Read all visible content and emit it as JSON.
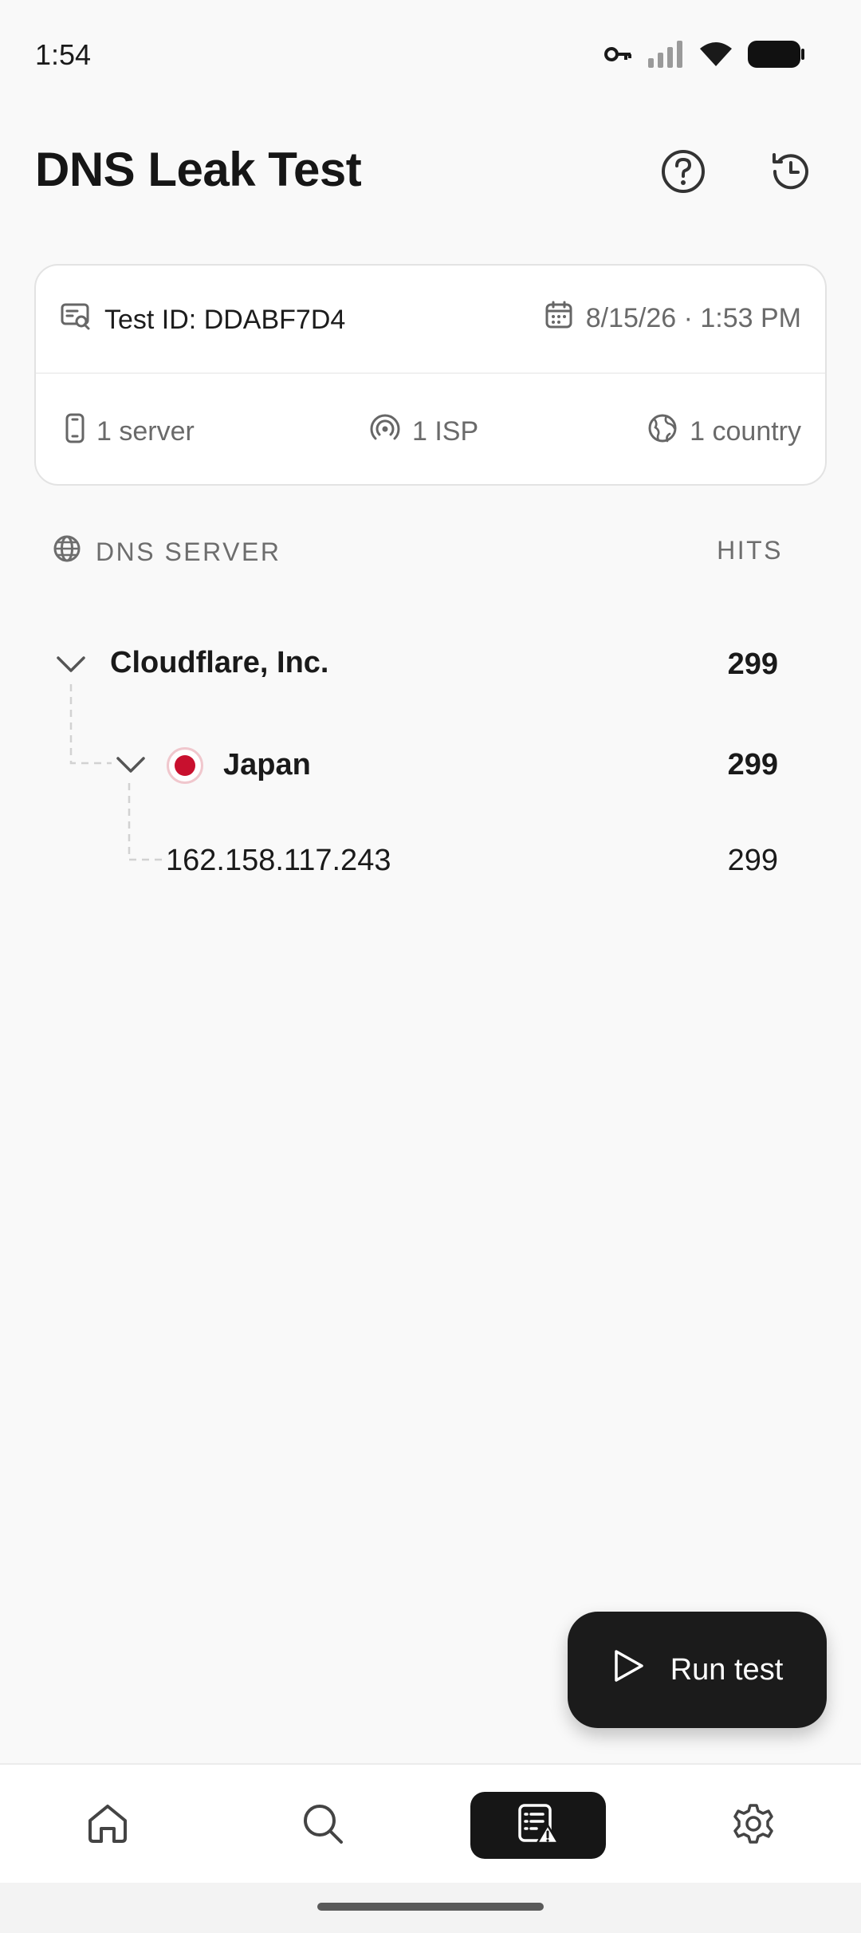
{
  "status_bar": {
    "time": "1:54",
    "icons": [
      "vpn-key-icon",
      "cellular-signal-icon",
      "wifi-icon",
      "battery-icon"
    ]
  },
  "header": {
    "title": "DNS Leak Test",
    "icons": [
      "help-icon",
      "history-icon"
    ]
  },
  "test_info": {
    "test_id": "Test ID: DDABF7D4",
    "date": "8/15/26 · 1:53 PM",
    "servers": "1 server",
    "isps": "1 ISP",
    "countries": "1 country"
  },
  "list": {
    "header_left": "DNS SERVER",
    "header_right": "HITS",
    "provider": {
      "name": "Cloudflare, Inc.",
      "hits": "299"
    },
    "country": {
      "name": "Japan",
      "hits": "299",
      "flag_colors": [
        "#ffffff",
        "#c8102e"
      ]
    },
    "server": {
      "ip": "162.158.117.243",
      "hits": "299"
    }
  },
  "fab": {
    "label": "Run test",
    "icon": "play-icon"
  },
  "bottom_nav": {
    "items": [
      {
        "icon": "home-icon",
        "active": false
      },
      {
        "icon": "search-icon",
        "active": false
      },
      {
        "icon": "dns-leak-report-icon",
        "active": true
      },
      {
        "icon": "settings-gear-icon",
        "active": false
      }
    ]
  },
  "colors": {
    "background": "#f9f9f9",
    "card": "#ffffff",
    "primary_dark": "#1b1b1b",
    "muted_text": "#6a6a6a",
    "japan_red": "#c8102e"
  }
}
